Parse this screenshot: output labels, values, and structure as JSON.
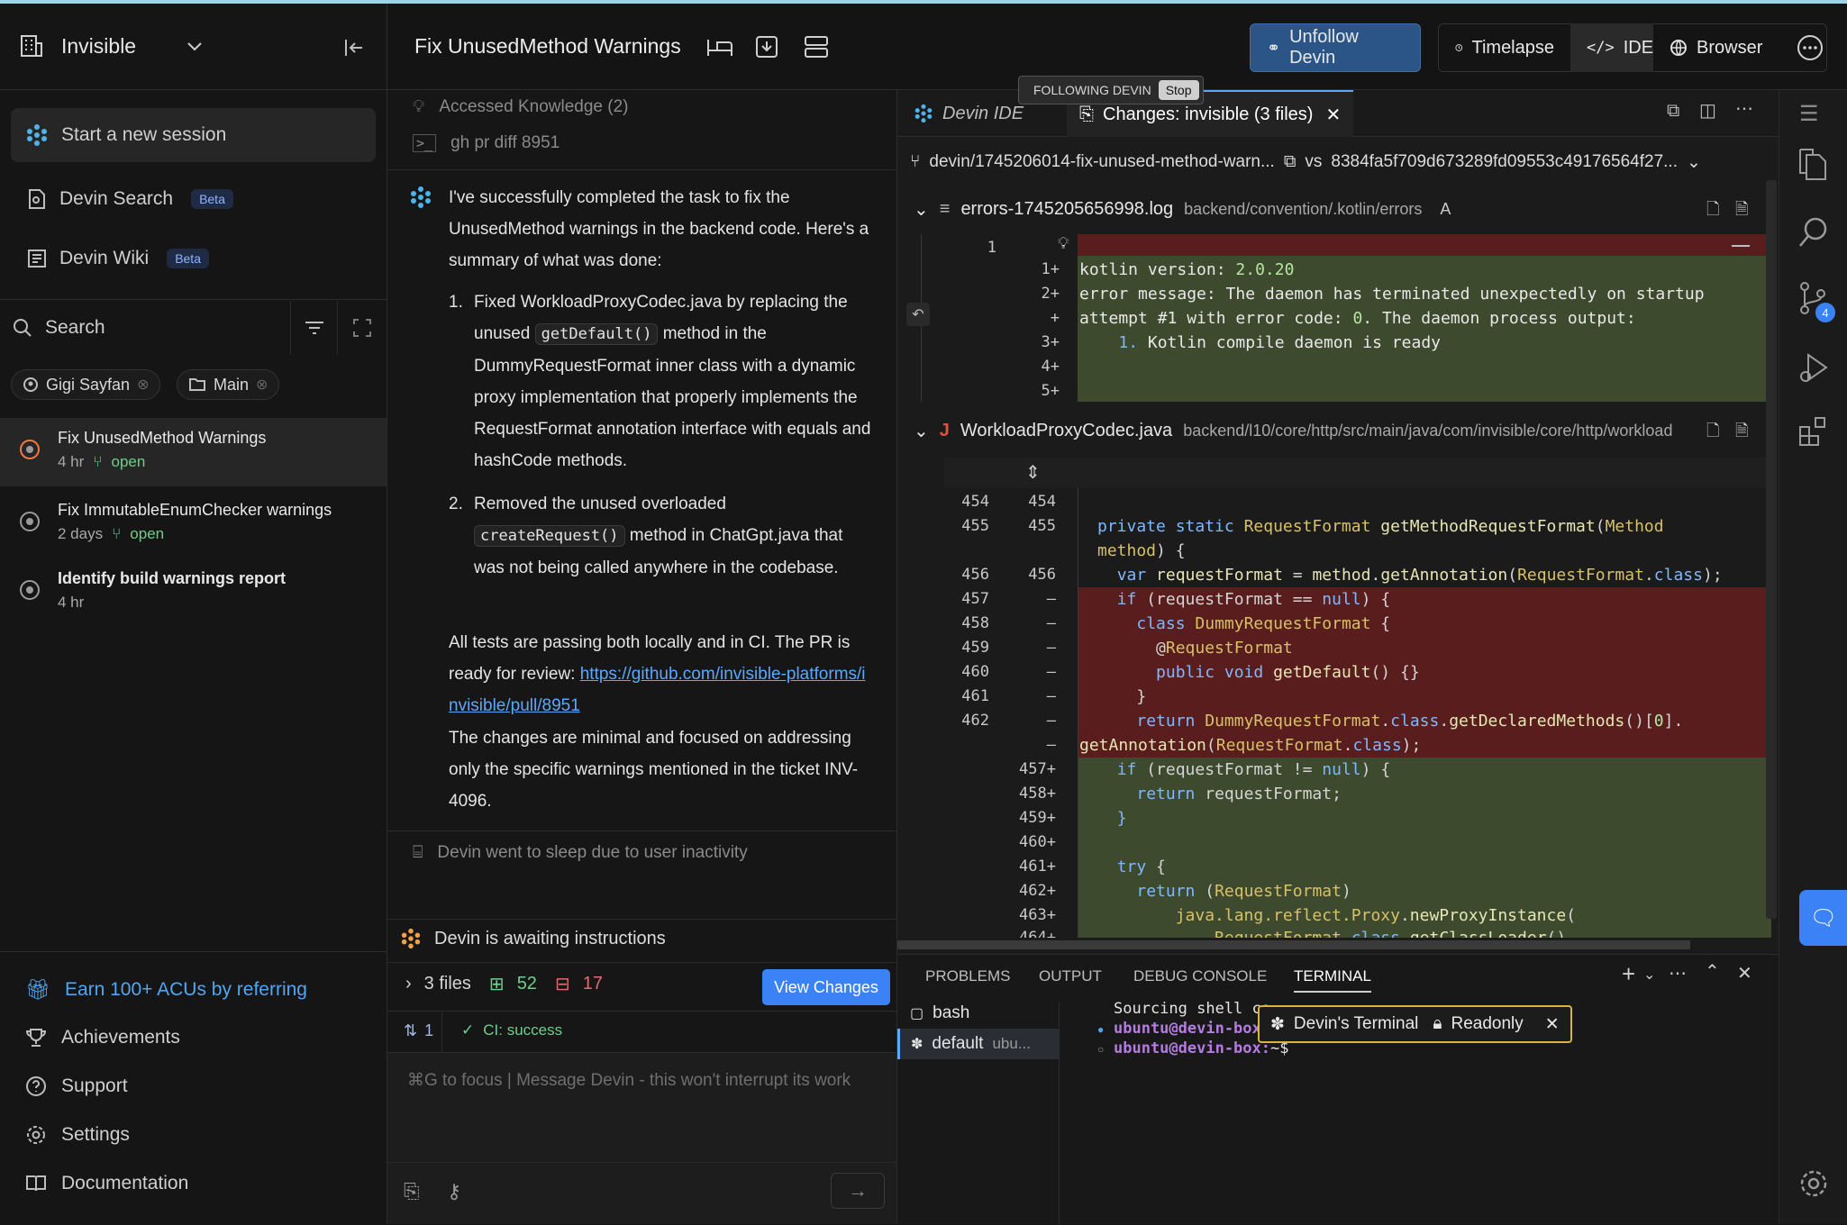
{
  "workspace": {
    "name": "Invisible"
  },
  "sidebar": {
    "nav": [
      {
        "label": "Start a new session"
      },
      {
        "label": "Devin Search",
        "badge": "Beta"
      },
      {
        "label": "Devin Wiki",
        "badge": "Beta"
      }
    ],
    "search_placeholder": "Search",
    "filters": [
      {
        "label": "Gigi Sayfan"
      },
      {
        "label": "Main"
      }
    ],
    "sessions": [
      {
        "title": "Fix UnusedMethod Warnings",
        "age": "4 hr",
        "status": "open"
      },
      {
        "title": "Fix ImmutableEnumChecker warnings",
        "age": "2 days",
        "status": "open"
      },
      {
        "title": "Identify build warnings report",
        "age": "4 hr",
        "status": ""
      }
    ],
    "footer": [
      {
        "label": "Earn 100+ ACUs by referring"
      },
      {
        "label": "Achievements"
      },
      {
        "label": "Support"
      },
      {
        "label": "Settings"
      },
      {
        "label": "Documentation"
      }
    ]
  },
  "header": {
    "title": "Fix UnusedMethod Warnings",
    "unfollow": "Unfollow Devin",
    "timelapse": "Timelapse",
    "ide": "IDE",
    "browser": "Browser",
    "following": "FOLLOWING DEVIN",
    "stop": "Stop"
  },
  "chat": {
    "steps": [
      "Accessed Knowledge (2)",
      "gh pr diff 8951"
    ],
    "intro": "I've successfully completed the task to fix the UnusedMethod warnings in the backend code. Here's a summary of what was done:",
    "item1": {
      "num": "1.",
      "a": "Fixed WorkloadProxyCodec.java by replacing the unused ",
      "code": "getDefault()",
      "b": " method in the DummyRequestFormat inner class with a dynamic proxy implementation that properly implements the RequestFormat annotation interface with equals and hashCode methods."
    },
    "item2": {
      "num": "2.",
      "a": "Removed the unused overloaded ",
      "code": "createRequest()",
      "b": " method in ChatGpt.java that was not being called anywhere in the codebase."
    },
    "tests": "All tests are passing both locally and in CI. The PR is ready for review: ",
    "pr_link": "https://github.com/invisible-platforms/invisible/pull/8951",
    "outro": "The changes are minimal and focused on addressing only the specific warnings mentioned in the ticket INV-4096.",
    "sleep": "Devin went to sleep due to user inactivity",
    "awaiting": "Devin is awaiting instructions",
    "files": "3 files",
    "added": "52",
    "removed": "17",
    "view_changes": "View Changes",
    "pr_count": "1",
    "ci": "CI: success",
    "input_placeholder": "⌘G to focus | Message Devin - this won't interrupt its work"
  },
  "ide": {
    "tab1": "Devin IDE",
    "tab2": "Changes: invisible (3 files)",
    "branch": "devin/1745206014-fix-unused-method-warn...",
    "vs": "vs",
    "commit": "8384fa5f709d673289fd09553c49176564f27...",
    "file1": {
      "name": "errors-1745205656998.log",
      "path": "backend/convention/.kotlin/errors",
      "status": "A"
    },
    "file2": {
      "name": "WorkloadProxyCodec.java",
      "path": "backend/l10/core/http/src/main/java/com/invisible/core/http/workload"
    }
  },
  "terminal": {
    "tabs": [
      "PROBLEMS",
      "OUTPUT",
      "DEBUG CONSOLE",
      "TERMINAL"
    ],
    "shells": [
      "bash",
      "default"
    ],
    "default_sub": "ubu...",
    "line1": "Sourcing shell co",
    "prompt": "ubuntu@devin-box:",
    "prompt2": "~$",
    "overlay_title": "Devin's Terminal",
    "overlay_mode": "Readonly"
  },
  "colors": {
    "accent": "#3b82f6",
    "unfollow_bg": "#274a7a",
    "overlay_border": "#d8b43a",
    "deleted": "#5a1d1d",
    "added": "#3d4a2e"
  }
}
